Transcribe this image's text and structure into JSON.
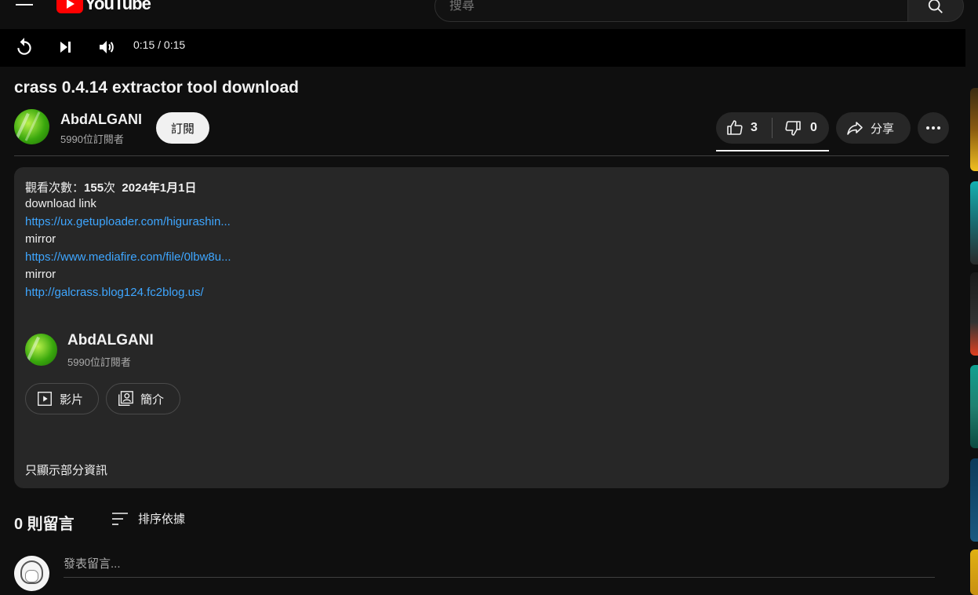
{
  "masthead": {
    "logo_text": "YouTube",
    "search_placeholder": "搜尋"
  },
  "player": {
    "time": "0:15 / 0:15"
  },
  "video": {
    "title": "crass 0.4.14 extractor tool download",
    "channel_name": "AbdALGANI",
    "subscribers": "5990位訂閱者",
    "subscribe_label": "訂閱",
    "likes": "3",
    "dislikes": "0",
    "share_label": "分享"
  },
  "description": {
    "views_label": "觀看次數：",
    "views_count": "155",
    "views_unit": "次",
    "date": "2024年1月1日",
    "lines": [
      {
        "text": "download link",
        "is_link": false
      },
      {
        "text": "https://ux.getuploader.com/higurashin...",
        "is_link": true
      },
      {
        "text": "mirror",
        "is_link": false
      },
      {
        "text": "https://www.mediafire.com/file/0lbw8u...",
        "is_link": true
      },
      {
        "text": "mirror",
        "is_link": false
      },
      {
        "text": "http://galcrass.blog124.fc2blog.us/",
        "is_link": true
      }
    ],
    "channel_name": "AbdALGANI",
    "channel_subscribers": "5990位訂閱者",
    "videos_label": "影片",
    "about_label": "簡介",
    "show_less": "只顯示部分資訊"
  },
  "comments": {
    "count_label": "0 則留言",
    "sort_label": "排序依據",
    "input_placeholder": "發表留言..."
  },
  "colors": {
    "background": "#0f0f0f",
    "link": "#3ea6ff",
    "brand_red": "#ff0000",
    "panel": "#272727"
  }
}
